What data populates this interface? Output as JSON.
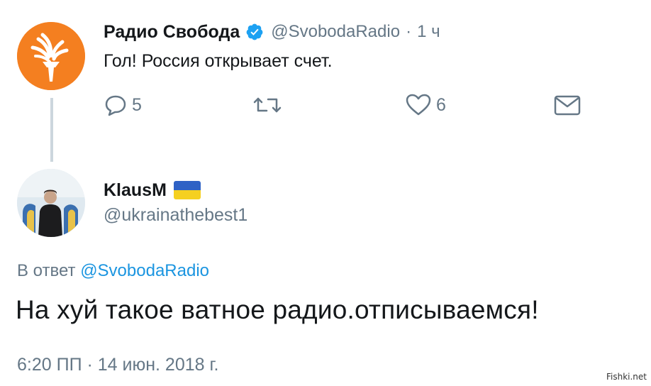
{
  "colors": {
    "text_primary": "#14171a",
    "text_secondary": "#657786",
    "link": "#1b95e0",
    "brand_orange": "#f47f20",
    "verified_blue": "#1da1f2"
  },
  "parent_tweet": {
    "author_name": "Радио Свобода",
    "handle": "@SvobodaRadio",
    "separator": "·",
    "time": "1 ч",
    "text": "Гол! Россия открывает счет.",
    "verified_icon": "verified-badge-icon",
    "avatar_icon": "radio-svoboda-torch-logo",
    "actions": {
      "reply_count": "5",
      "retweet_count": "",
      "like_count": "6"
    }
  },
  "reply_tweet": {
    "author_name": "KlausM",
    "flag_icon": "ukraine-flag-icon",
    "handle": "@ukrainathebest1",
    "in_reply_prefix": "В ответ",
    "in_reply_mention": "@SvobodaRadio",
    "text": "На хуй такое ватное радио.отписываемся!",
    "timestamp": "6:20 ПП · 14 июн. 2018 г."
  },
  "watermark": "Fishki.net"
}
